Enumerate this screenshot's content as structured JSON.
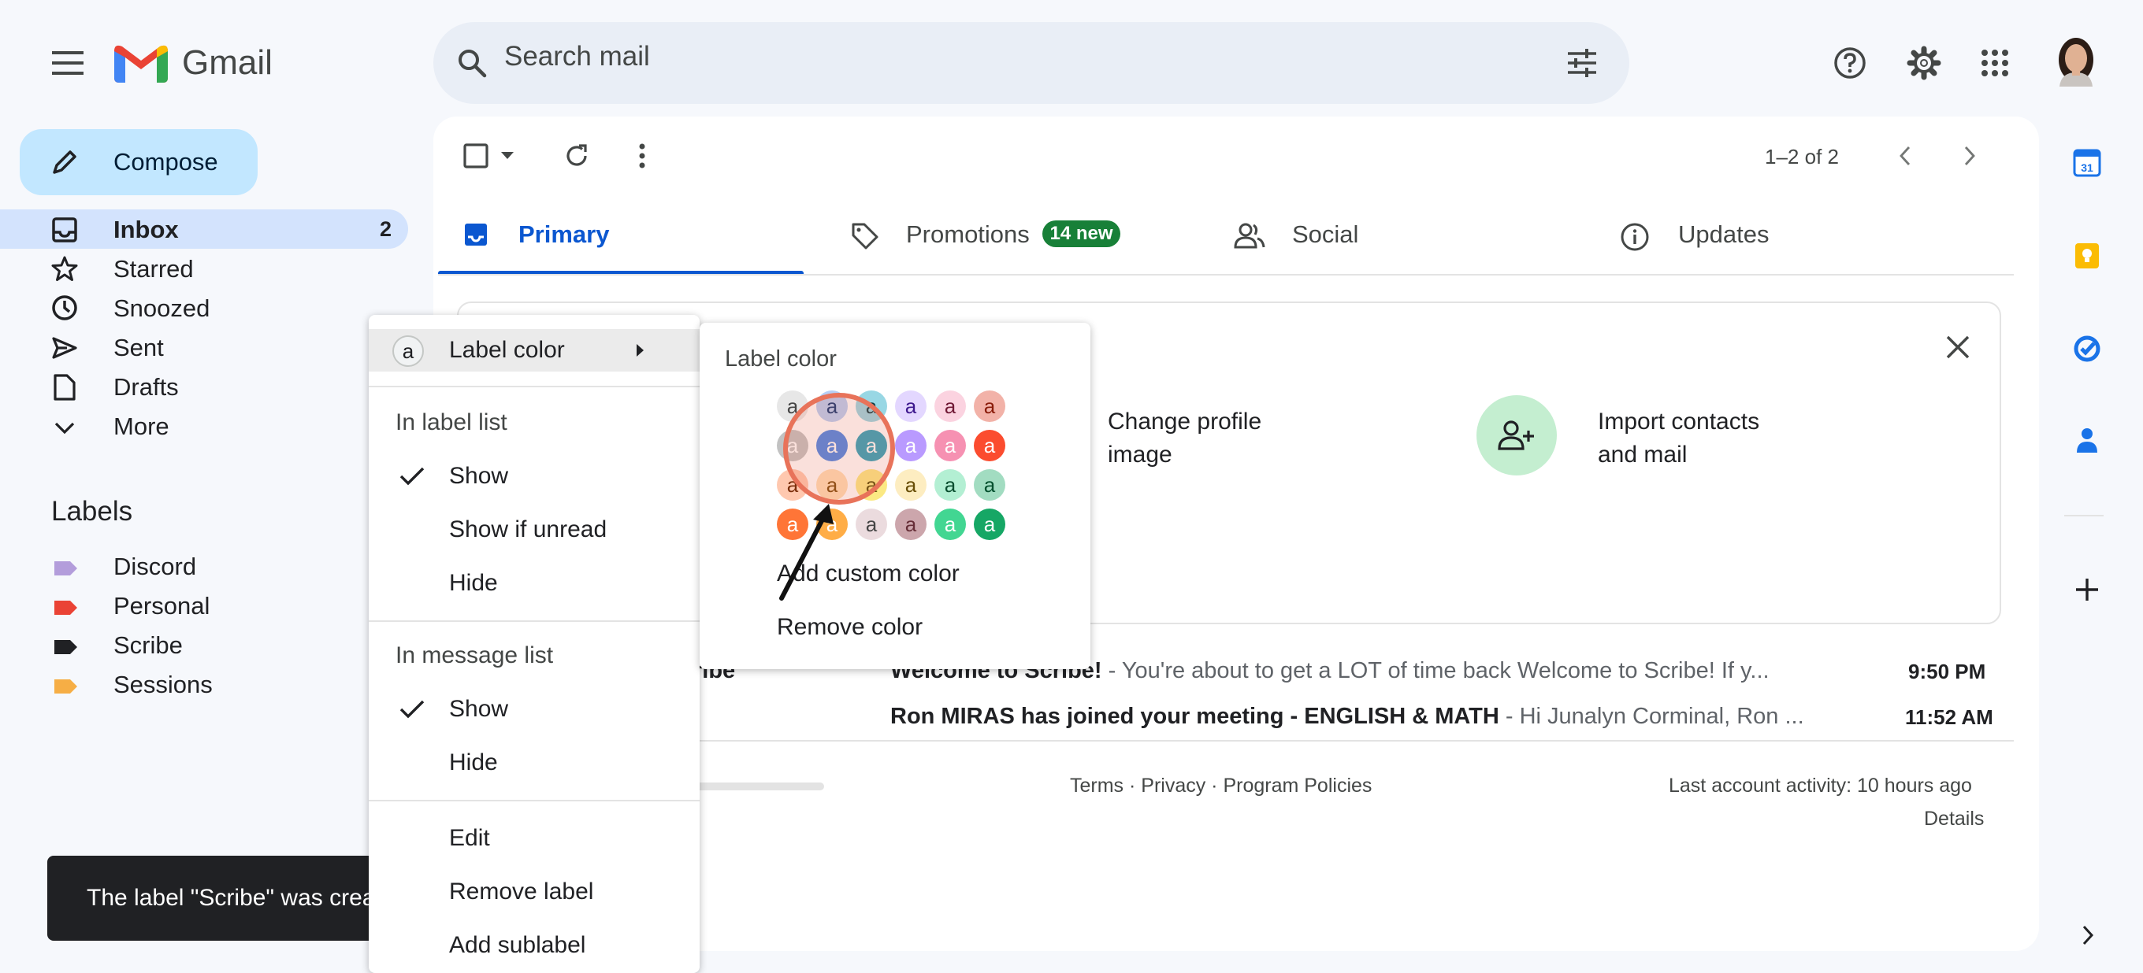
{
  "app": {
    "logo_text": "Gmail"
  },
  "header": {
    "search_placeholder": "Search mail"
  },
  "sidebar": {
    "compose_label": "Compose",
    "items": [
      {
        "label": "Inbox",
        "count": "2"
      },
      {
        "label": "Starred"
      },
      {
        "label": "Snoozed"
      },
      {
        "label": "Sent"
      },
      {
        "label": "Drafts"
      },
      {
        "label": "More"
      }
    ],
    "labels_heading": "Labels",
    "labels": [
      {
        "name": "Discord",
        "color": "#b39ddb"
      },
      {
        "name": "Personal",
        "color": "#ea4335"
      },
      {
        "name": "Scribe",
        "color": "#202124"
      },
      {
        "name": "Sessions",
        "color": "#f6ae45"
      }
    ]
  },
  "toolbar": {
    "pagination": "1–2 of 2"
  },
  "tabs": [
    {
      "label": "Primary",
      "icon": "inbox-icon"
    },
    {
      "label": "Promotions",
      "icon": "tag-icon",
      "badge": "14 new"
    },
    {
      "label": "Social",
      "icon": "people-icon"
    },
    {
      "label": "Updates",
      "icon": "info-icon"
    }
  ],
  "setup_card": {
    "items": [
      {
        "label": "Change profile image"
      },
      {
        "label": "Import contacts and mail"
      }
    ]
  },
  "emails": [
    {
      "sender": "ribe",
      "subject": "Welcome to Scribe!",
      "snippet": " - You're about to get a LOT of time back  Welcome to Scribe! If y...",
      "time": "9:50 PM"
    },
    {
      "sender": "",
      "subject": "Ron MIRAS has joined your meeting - ENGLISH & MATH",
      "snippet": " - Hi Junalyn Corminal, Ron ...",
      "time": "11:52 AM"
    }
  ],
  "footer": {
    "links": "Terms · Privacy · Program Policies",
    "activity": "Last account activity: 10 hours ago",
    "details": "Details"
  },
  "context_menu": {
    "label_color": "Label color",
    "in_label_list": "In label list",
    "label_list_options": [
      "Show",
      "Show if unread",
      "Hide"
    ],
    "in_message_list": "In message list",
    "message_list_options": [
      "Show",
      "Hide"
    ],
    "actions": [
      "Edit",
      "Remove label",
      "Add sublabel"
    ]
  },
  "color_submenu": {
    "title": "Label color",
    "swatch_letter": "a",
    "swatches": [
      [
        "#e7e7e7",
        "#b6cff5",
        "#98d7e4",
        "#e3d7ff",
        "#fbd3e0",
        "#f2b2a8"
      ],
      [
        "#c2c2c2",
        "#4986e7",
        "#2da2bb",
        "#b99aff",
        "#f691b2",
        "#fb4c2f"
      ],
      [
        "#ffc8af",
        "#ffdeb5",
        "#fbe983",
        "#fdedc1",
        "#b3efd3",
        "#a2dcc1"
      ],
      [
        "#ff7537",
        "#ffad46",
        "#ebdbde",
        "#cca6ac",
        "#42d692",
        "#16a765"
      ]
    ],
    "swatch_text_colors": [
      [
        "#464646",
        "#0d3472",
        "#0d3b44",
        "#3d188e",
        "#711a36",
        "#8a1c0a"
      ],
      [
        "#ffffff",
        "#ffffff",
        "#ffffff",
        "#ffffff",
        "#ffffff",
        "#ffffff"
      ],
      [
        "#7a2e0b",
        "#7a4706",
        "#594c05",
        "#684e07",
        "#0b4f30",
        "#04502e"
      ],
      [
        "#ffffff",
        "#ffffff",
        "#464646",
        "#662e37",
        "#ffffff",
        "#ffffff"
      ]
    ],
    "add_custom": "Add custom color",
    "remove": "Remove color"
  },
  "snackbar": {
    "message": "The label \"Scribe\" was created."
  },
  "annotation": {
    "circle_color": "#e8735a",
    "arrow_color": "#111111"
  }
}
